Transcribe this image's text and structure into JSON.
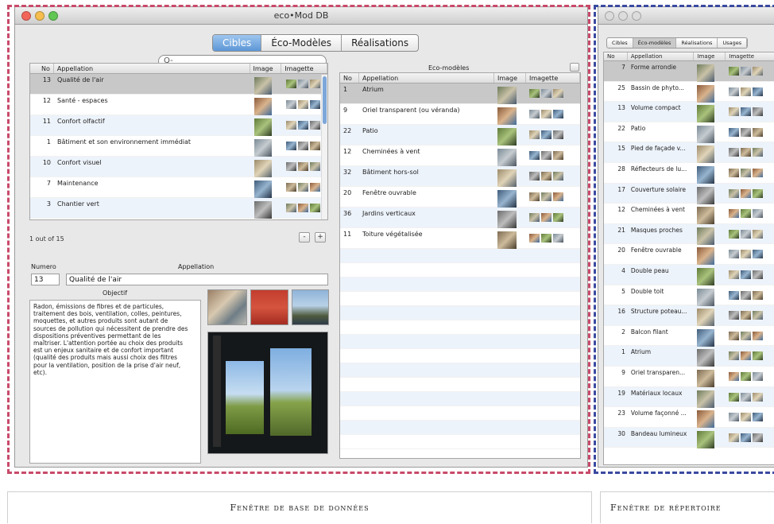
{
  "db_window": {
    "title": "eco•Mod DB",
    "tabs": [
      "Cibles",
      "Éco-Modèles",
      "Réalisations"
    ],
    "active_tab": "Cibles",
    "search_icon": "Q-",
    "cibles_table": {
      "headers": [
        "No",
        "Appellation",
        "Image",
        "Imagette"
      ],
      "rows": [
        {
          "no": "13",
          "name": "Qualité de l'air",
          "selected": true
        },
        {
          "no": "12",
          "name": "Santé - espaces"
        },
        {
          "no": "11",
          "name": "Confort olfactif"
        },
        {
          "no": "1",
          "name": "Bâtiment et son environnement immédiat"
        },
        {
          "no": "10",
          "name": "Confort visuel"
        },
        {
          "no": "7",
          "name": "Maintenance"
        },
        {
          "no": "3",
          "name": "Chantier vert"
        }
      ]
    },
    "count_text": "1 out of 15",
    "minus_label": "-",
    "plus_label": "+",
    "detail": {
      "numero_label": "Numero",
      "appellation_label": "Appellation",
      "numero_value": "13",
      "appellation_value": "Qualité de l'air",
      "objectif_label": "Objectif",
      "objectif_text": "Radon, émissions de fibres et de particules,\ntraitement des bois, ventilation, colles, peintures,\nmoquettes, et autres produits sont autant de\nsources de pollution qui nécessitent de prendre des\ndispositions préventives permettant de les\nmaîtriser. L'attention portée au choix des produits\nest un enjeux sanitaire et de confort important\n(qualité des produits mais aussi choix des filtres\npour la ventilation, position de la prise d'air neuf,\netc)."
    },
    "eco_modeles": {
      "title": "Eco-modèles",
      "headers": [
        "No",
        "Appellation",
        "Image",
        "Imagette"
      ],
      "rows": [
        {
          "no": "1",
          "name": "Atrium",
          "selected": true
        },
        {
          "no": "9",
          "name": "Oriel transparent (ou véranda)"
        },
        {
          "no": "22",
          "name": "Patio"
        },
        {
          "no": "12",
          "name": "Cheminées à vent"
        },
        {
          "no": "32",
          "name": "Bâtiment hors-sol"
        },
        {
          "no": "20",
          "name": "Fenêtre ouvrable"
        },
        {
          "no": "36",
          "name": "Jardins verticaux"
        },
        {
          "no": "11",
          "name": "Toiture végétalisée"
        }
      ]
    }
  },
  "repertoire_window": {
    "tabs": [
      "Cibles",
      "Éco-modèles",
      "Réalisations",
      "Usages"
    ],
    "active_tab": "Éco-modèles",
    "headers": [
      "No",
      "Appellation",
      "Image",
      "Imagette"
    ],
    "rows": [
      {
        "no": "7",
        "name": "Forme arrondie",
        "selected": true
      },
      {
        "no": "25",
        "name": "Bassin de phyto..."
      },
      {
        "no": "13",
        "name": "Volume compact"
      },
      {
        "no": "22",
        "name": "Patio"
      },
      {
        "no": "15",
        "name": "Pied de façade v..."
      },
      {
        "no": "28",
        "name": "Réflecteurs de lu..."
      },
      {
        "no": "17",
        "name": "Couverture solaire"
      },
      {
        "no": "12",
        "name": "Cheminées à vent"
      },
      {
        "no": "21",
        "name": "Masques proches"
      },
      {
        "no": "20",
        "name": "Fenêtre ouvrable"
      },
      {
        "no": "4",
        "name": "Double peau"
      },
      {
        "no": "5",
        "name": "Double toit"
      },
      {
        "no": "16",
        "name": "Structure poteau..."
      },
      {
        "no": "2",
        "name": "Balcon filant"
      },
      {
        "no": "1",
        "name": "Atrium"
      },
      {
        "no": "9",
        "name": "Oriel transparen..."
      },
      {
        "no": "19",
        "name": "Matériaux locaux"
      },
      {
        "no": "23",
        "name": "Volume façonné ..."
      },
      {
        "no": "30",
        "name": "Bandeau lumineux"
      }
    ]
  },
  "captions": {
    "db": "Fenêtre de base de données",
    "repertoire": "Fenêtre de répertoire"
  },
  "colors": {
    "db_frame": "#c84a6a",
    "rep_frame": "#3a4aa0",
    "selection": "#c8c8c8",
    "active_tab": "#5d96d6"
  }
}
